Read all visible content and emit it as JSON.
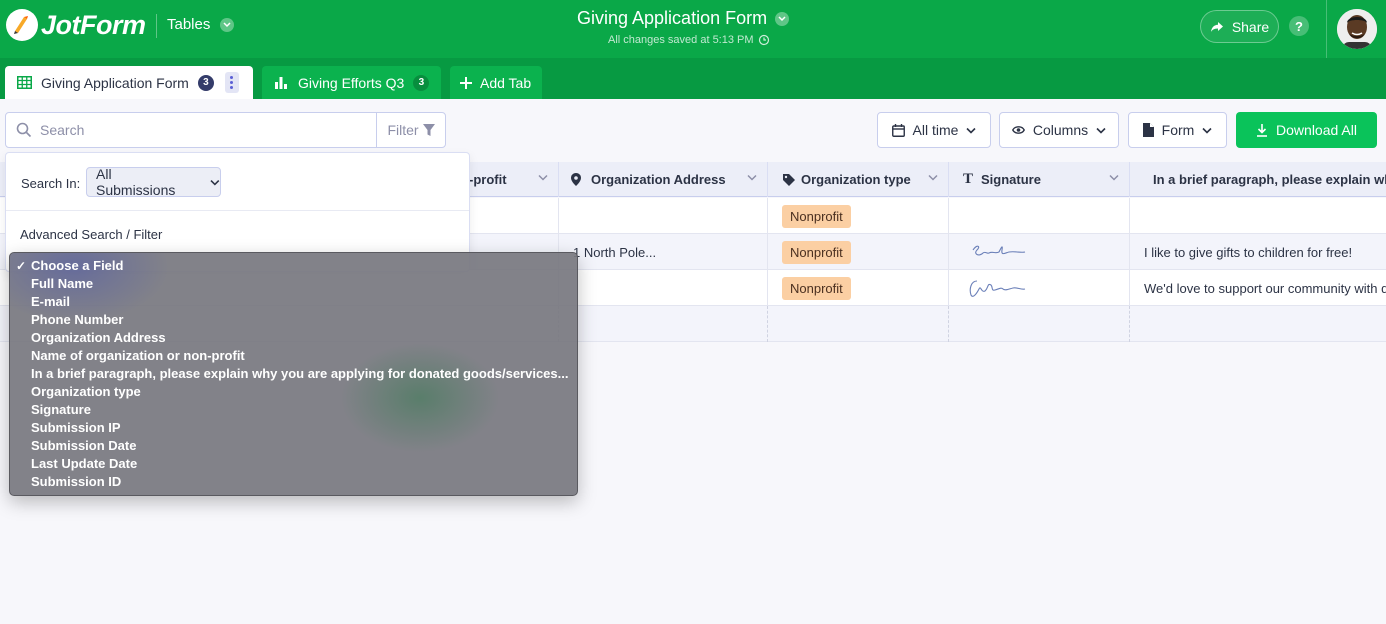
{
  "header": {
    "logo_text": "JotForm",
    "tables_label": "Tables",
    "form_title": "Giving Application Form",
    "saved_status": "All changes saved at 5:13 PM",
    "share_label": "Share",
    "help_label": "?",
    "brand_color": "#0aa848"
  },
  "tabs": [
    {
      "label": "Giving Application Form",
      "count": "3"
    },
    {
      "label": "Giving Efforts Q3",
      "count": "3"
    },
    {
      "label": "Add Tab"
    }
  ],
  "toolbar": {
    "search_placeholder": "Search",
    "filter_label": "Filter",
    "date_range_label": "All time",
    "columns_label": "Columns",
    "form_label": "Form",
    "download_label": "Download All"
  },
  "table": {
    "columns": [
      {
        "label": "-profit",
        "icon": "text-icon"
      },
      {
        "label": "Organization Address",
        "icon": "map-pin-icon"
      },
      {
        "label": "Organization type",
        "icon": "tag-icon"
      },
      {
        "label": "Signature",
        "icon": "text-t-icon"
      },
      {
        "label": "In a brief paragraph, please explain wh",
        "icon": "paragraph-icon"
      }
    ],
    "rows": [
      {
        "address": "",
        "type": "Nonprofit",
        "signature": "",
        "paragraph": ""
      },
      {
        "address": "1 North Pole...",
        "type": "Nonprofit",
        "signature": "signature-image",
        "paragraph": "I like to give gifts to children for free!"
      },
      {
        "address": "",
        "type": "Nonprofit",
        "signature": "signature-image",
        "paragraph": "We'd love to support our community with d"
      }
    ]
  },
  "search_popover": {
    "search_in_label": "Search In:",
    "search_in_value": "All Submissions",
    "advanced_label": "Advanced Search / Filter"
  },
  "field_dropdown": {
    "selected": "Choose a Field",
    "options": [
      "Choose a Field",
      "Full Name",
      "E-mail",
      "Phone Number",
      "Organization Address",
      "Name of organization or non-profit",
      "In a brief paragraph, please explain why you are applying for donated goods/services...",
      "Organization type",
      "Signature",
      "Submission IP",
      "Submission Date",
      "Last Update Date",
      "Submission ID"
    ]
  }
}
